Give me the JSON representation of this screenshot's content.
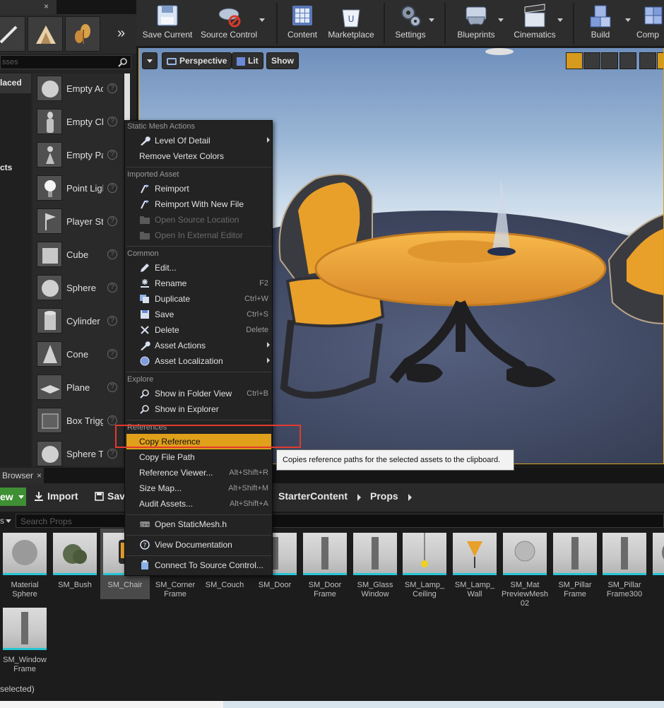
{
  "left_panel": {
    "search_placeholder": "sses",
    "categories": [
      "laced",
      "cts"
    ],
    "place_items": [
      {
        "label": "Empty Ac"
      },
      {
        "label": "Empty Ch"
      },
      {
        "label": "Empty Pa"
      },
      {
        "label": "Point Ligl"
      },
      {
        "label": "Player St"
      },
      {
        "label": "Cube"
      },
      {
        "label": "Sphere"
      },
      {
        "label": "Cylinder"
      },
      {
        "label": "Cone"
      },
      {
        "label": "Plane"
      },
      {
        "label": "Box Trigg"
      },
      {
        "label": "Sphere T"
      }
    ]
  },
  "toolbar": {
    "buttons": [
      {
        "label": "Save Current"
      },
      {
        "label": "Source Control"
      },
      {
        "label": "Content"
      },
      {
        "label": "Marketplace"
      },
      {
        "label": "Settings"
      },
      {
        "label": "Blueprints"
      },
      {
        "label": "Cinematics"
      },
      {
        "label": "Build"
      },
      {
        "label": "Comp"
      }
    ]
  },
  "viewport": {
    "perspective_label": "Perspective",
    "lit_label": "Lit",
    "show_label": "Show"
  },
  "context_menu": {
    "sections": [
      {
        "title": "Static Mesh Actions"
      },
      {
        "title": "Imported Asset"
      },
      {
        "title": "Common"
      },
      {
        "title": "Explore"
      },
      {
        "title": "References"
      }
    ],
    "items": {
      "level_of_detail": "Level Of Detail",
      "remove_vertex_colors": "Remove Vertex Colors",
      "reimport": "Reimport",
      "reimport_new_file": "Reimport With New File",
      "open_source_location": "Open Source Location",
      "open_external_editor": "Open In External Editor",
      "edit": "Edit...",
      "rename": "Rename",
      "rename_sc": "F2",
      "duplicate": "Duplicate",
      "duplicate_sc": "Ctrl+W",
      "save": "Save",
      "save_sc": "Ctrl+S",
      "delete": "Delete",
      "delete_sc": "Delete",
      "asset_actions": "Asset Actions",
      "asset_localization": "Asset Localization",
      "show_in_folder": "Show in Folder View",
      "show_in_folder_sc": "Ctrl+B",
      "show_in_explorer": "Show in Explorer",
      "copy_reference": "Copy Reference",
      "copy_file_path": "Copy File Path",
      "reference_viewer": "Reference Viewer...",
      "reference_viewer_sc": "Alt+Shift+R",
      "size_map": "Size Map...",
      "size_map_sc": "Alt+Shift+M",
      "audit_assets": "Audit Assets...",
      "audit_assets_sc": "Alt+Shift+A",
      "open_staticmesh_h": "Open StaticMesh.h",
      "view_documentation": "View Documentation",
      "connect_source_control": "Connect To Source Control..."
    }
  },
  "tooltip": "Copies reference paths for the selected assets to the clipboard.",
  "content_browser": {
    "tab_label": "Browser",
    "new_label": "ew",
    "import_label": "Import",
    "save_label": "Sav",
    "breadcrumbs": [
      "StarterContent",
      "Props"
    ],
    "filter_label": "s",
    "search_placeholder": "Search Props",
    "assets": [
      {
        "label": "Material\nSphere"
      },
      {
        "label": "SM_Bush"
      },
      {
        "label": "SM_Chair"
      },
      {
        "label": "SM_Corner\nFrame"
      },
      {
        "label": "SM_Couch"
      },
      {
        "label": "SM_Door"
      },
      {
        "label": "SM_Door\nFrame"
      },
      {
        "label": "SM_Glass\nWindow"
      },
      {
        "label": "SM_Lamp_\nCeiling"
      },
      {
        "label": "SM_Lamp_\nWall"
      },
      {
        "label": "SM_Mat\nPreviewMesh\n02"
      },
      {
        "label": "SM_Pillar\nFrame"
      },
      {
        "label": "SM_Pillar\nFrame300"
      },
      {
        "label": "SI"
      },
      {
        "label": "SM_Window\nFrame"
      }
    ],
    "status": " selected)"
  },
  "colors": {
    "highlight": "#e0a01a",
    "annotation_box": "#e33a2e",
    "new_button": "#3f8f34",
    "asset_underline": "#27c6d6"
  }
}
